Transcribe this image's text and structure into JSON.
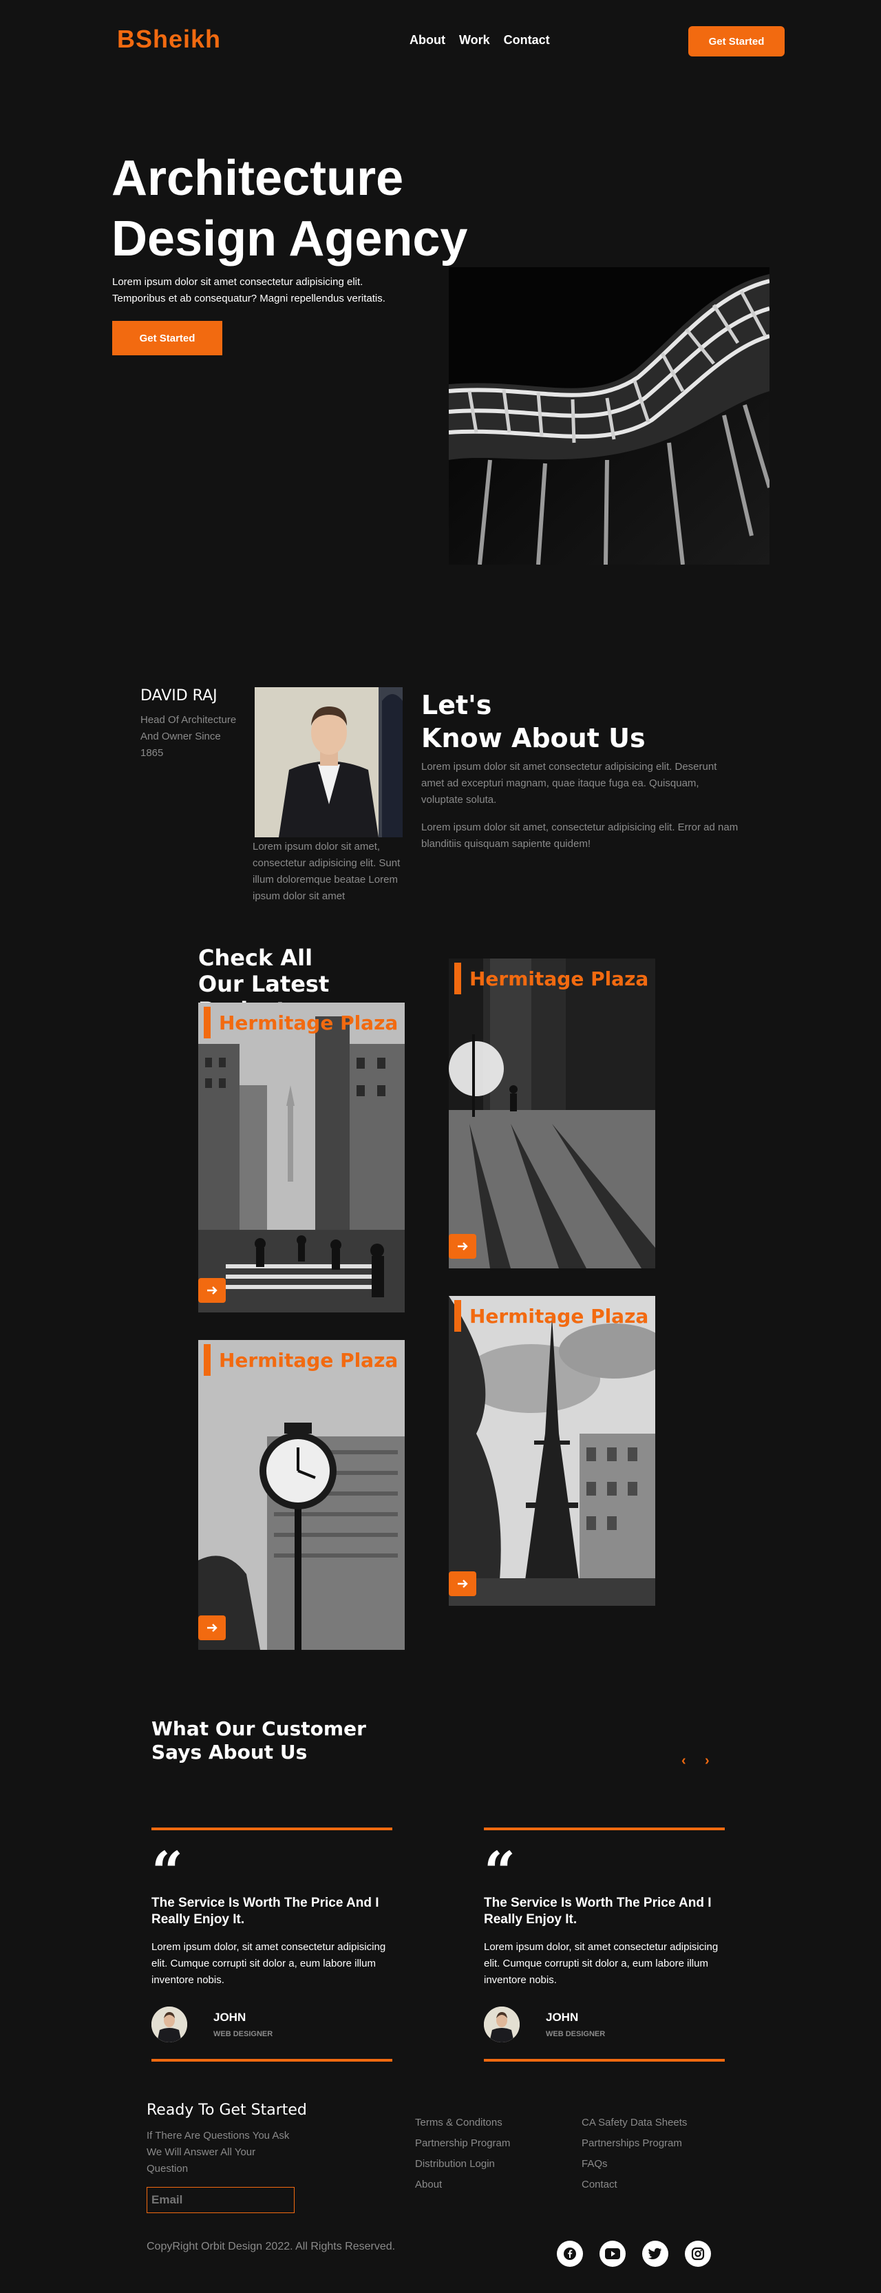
{
  "nav": {
    "logo": "BSheikh",
    "links": [
      "About",
      "Work",
      "Contact"
    ],
    "cta": "Get Started"
  },
  "hero": {
    "title_line1": "Architecture",
    "title_line2": "Design Agency",
    "subtitle": "Lorem ipsum dolor sit amet consectetur adipisicing elit. Temporibus et ab consequatur? Magni repellendus veritatis.",
    "cta": "Get Started"
  },
  "about": {
    "name": "DAVID RAJ",
    "role": "Head Of Architecture And Owner Since 1865",
    "caption": "Lorem ipsum dolor sit amet, consectetur adipisicing elit. Sunt illum doloremque beatae Lorem ipsum dolor sit amet",
    "heading_line1": "Let's",
    "heading_line2": "Know About Us",
    "paragraph1": "Lorem ipsum dolor sit amet consectetur adipisicing elit. Deserunt amet ad excepturi magnam, quae itaque fuga ea. Quisquam, voluptate soluta.",
    "paragraph2": "Lorem ipsum dolor sit amet, consectetur adipisicing elit. Error ad nam blanditiis quisquam sapiente quidem!"
  },
  "projects": {
    "heading_line1": "Check All",
    "heading_line2": "Our Latest Projects",
    "cards": [
      {
        "title": "Hermitage Plaza"
      },
      {
        "title": "Hermitage Plaza"
      },
      {
        "title": "Hermitage Plaza"
      },
      {
        "title": "Hermitage Plaza"
      }
    ]
  },
  "testimonials": {
    "heading_line1": "What Our Customer",
    "heading_line2": "Says About Us",
    "prev": "‹",
    "next": "›",
    "items": [
      {
        "quote": "The Service Is Worth The Price And I Really Enjoy It.",
        "body": "Lorem ipsum dolor, sit amet consectetur adipisicing elit. Cumque corrupti sit dolor a, eum labore illum inventore nobis.",
        "name": "JOHN",
        "role": "WEB DESIGNER"
      },
      {
        "quote": "The Service Is Worth The Price And I Really Enjoy It.",
        "body": "Lorem ipsum dolor, sit amet consectetur adipisicing elit. Cumque corrupti sit dolor a, eum labore illum inventore nobis.",
        "name": "JOHN",
        "role": "WEB DESIGNER"
      }
    ]
  },
  "footer": {
    "title": "Ready To Get Started",
    "subtitle": "If There Are Questions You Ask We Will Answer All Your Question",
    "email_placeholder": "Email",
    "links_col1": [
      "Terms & Conditons",
      "Partnership Program",
      "Distribution Login",
      "About"
    ],
    "links_col2": [
      "CA Safety Data Sheets",
      "Partnerships Program",
      "FAQs",
      "Contact"
    ],
    "copyright": "CopyRight Orbit Design 2022. All Rights Reserved.",
    "social": [
      "facebook-icon",
      "youtube-icon",
      "twitter-icon",
      "instagram-icon"
    ]
  },
  "colors": {
    "accent": "#f26a10",
    "background": "#121212",
    "muted_text": "#8a8a8a"
  }
}
